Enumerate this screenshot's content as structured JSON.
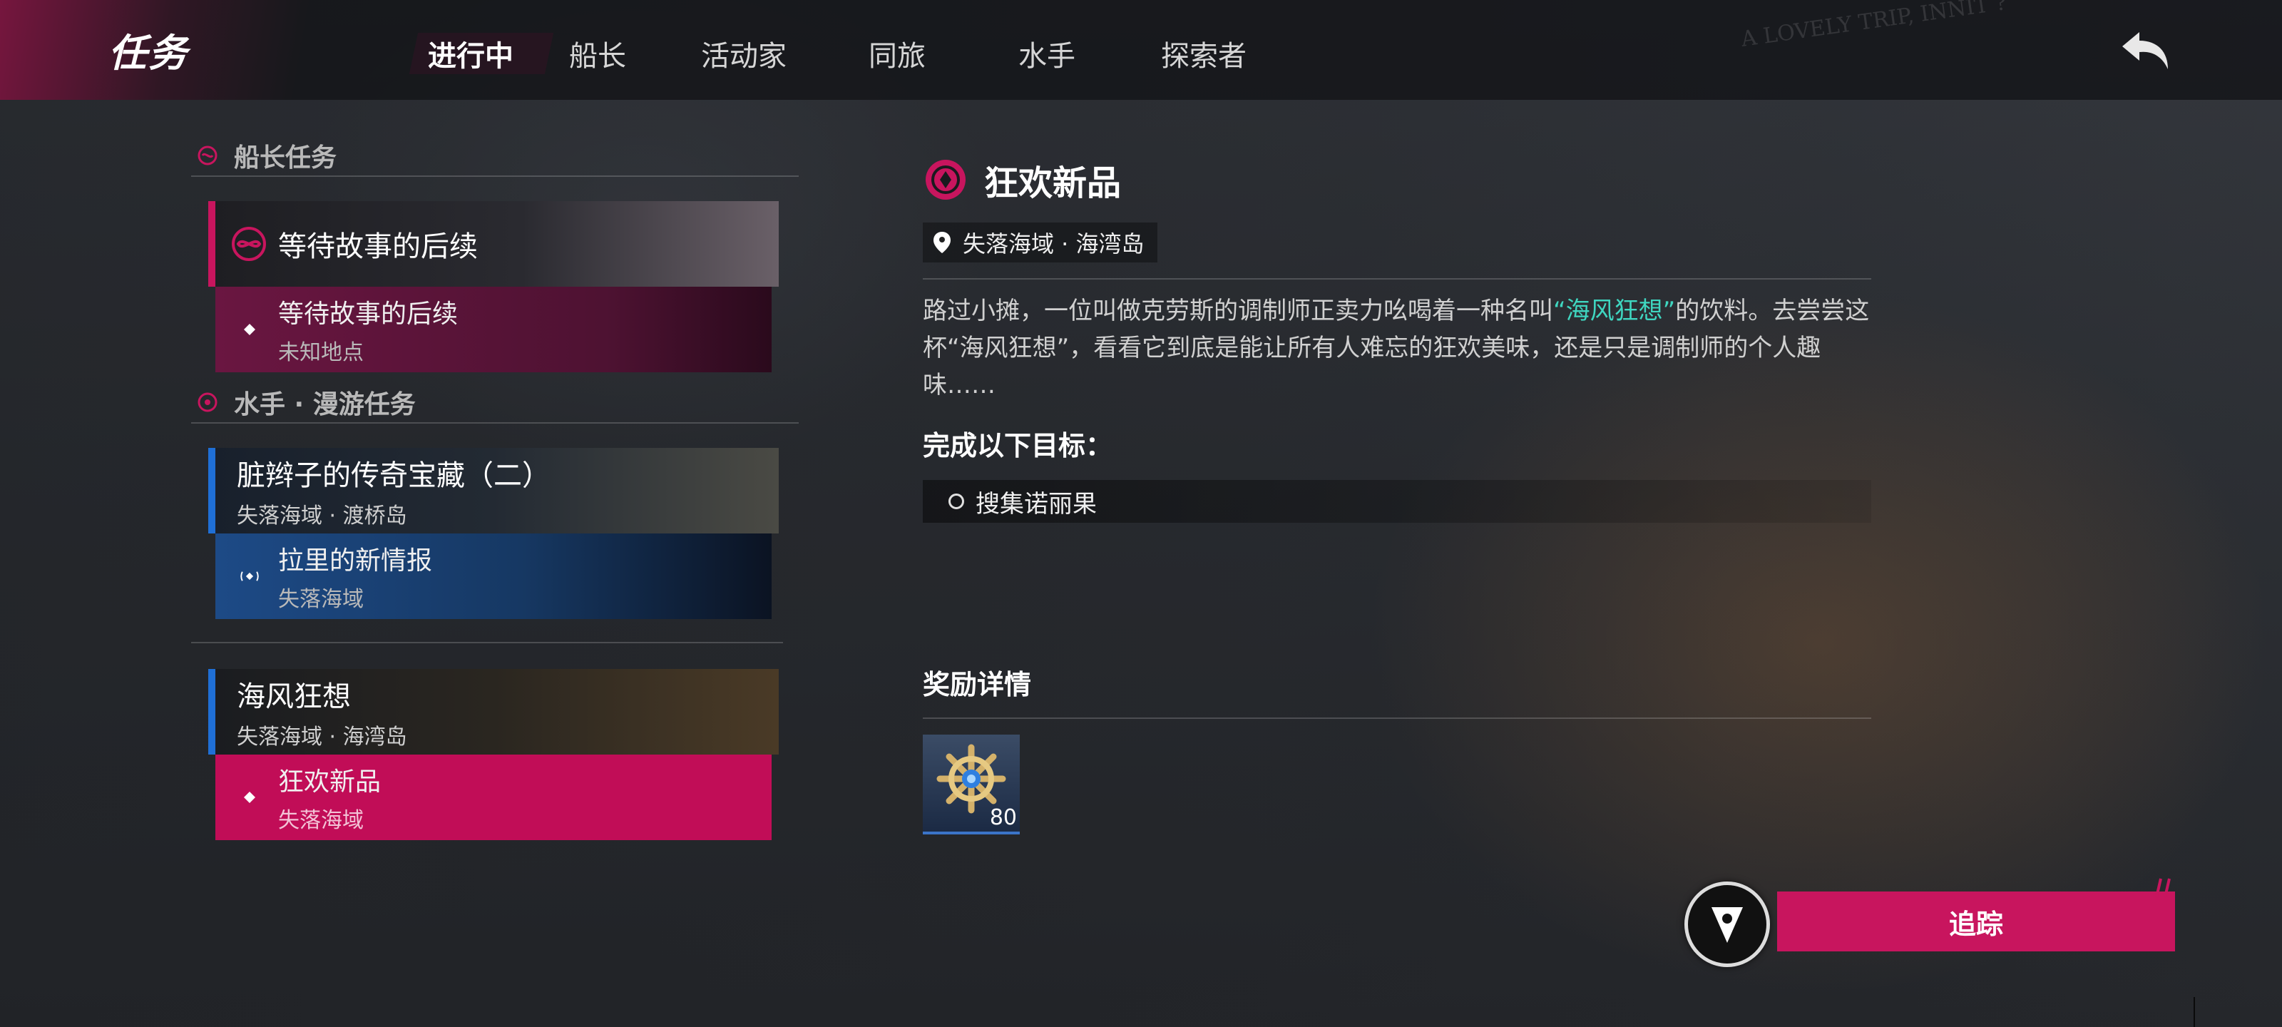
{
  "header": {
    "title": "任务",
    "tabs": [
      {
        "label": "进行中",
        "active": true
      },
      {
        "label": "船长"
      },
      {
        "label": "活动家"
      },
      {
        "label": "同旅"
      },
      {
        "label": "水手"
      },
      {
        "label": "探索者"
      }
    ],
    "back_icon": "back-arrow-icon",
    "bg_text": "A LOVELY TRIP, INNIT ?"
  },
  "sections": [
    {
      "title": "船长任务",
      "groups": [
        {
          "title": "等待故事的后续",
          "subtitle": "",
          "accent": "#c8155e",
          "subs": [
            {
              "name": "等待故事的后续",
              "location": "未知地点",
              "style": "magenta-dark"
            }
          ]
        }
      ]
    },
    {
      "title": "水手 · 漫游任务",
      "groups": [
        {
          "title": "脏辫子的传奇宝藏（二）",
          "subtitle": "失落海域 · 渡桥岛",
          "accent": "#1f6fd6",
          "subs": [
            {
              "name": "拉里的新情报",
              "location": "失落海域",
              "style": "blue"
            }
          ]
        },
        {
          "title": "海风狂想",
          "subtitle": "失落海域 · 海湾岛",
          "accent": "#1f6fd6",
          "subs": [
            {
              "name": "狂欢新品",
              "location": "失落海域",
              "style": "selected"
            }
          ]
        }
      ]
    }
  ],
  "detail": {
    "title": "狂欢新品",
    "location": "失落海域 · 海湾岛",
    "desc_part1": "路过小摊，一位叫做克劳斯的调制师正卖力吆喝着一种名叫",
    "desc_highlight": "“海风狂想”",
    "desc_part2": "的饮料。去尝尝这杯“海风狂想”，看看它到底是能让所有人难忘的狂欢美味，还是只是调制师的个人趣味……",
    "goals_heading": "完成以下目标：",
    "goals": [
      "搜集诺丽果"
    ],
    "rewards_heading": "奖励详情",
    "rewards": [
      {
        "icon": "ship-wheel-gem-icon",
        "count": "80"
      }
    ]
  },
  "track_label": "追踪",
  "colors": {
    "accent": "#c8155e",
    "blue": "#1f6fd6",
    "highlight": "#3fd6c0"
  }
}
